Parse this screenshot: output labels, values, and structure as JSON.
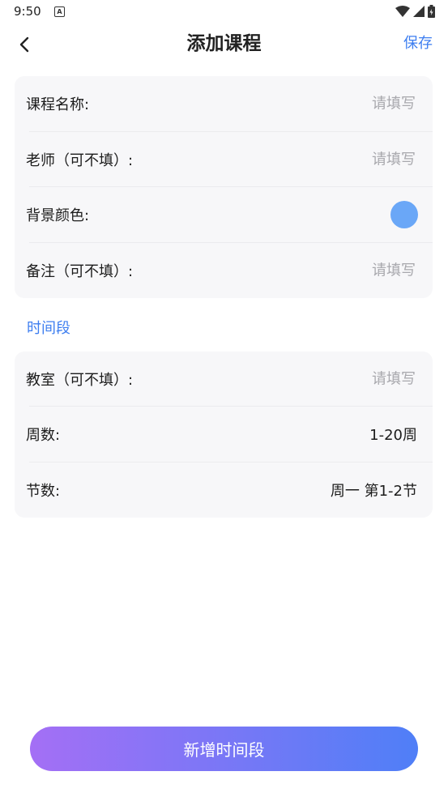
{
  "status_bar": {
    "time": "9:50",
    "a_icon_glyph": "A",
    "icons": [
      "wifi-icon",
      "signal-icon",
      "battery-icon"
    ]
  },
  "header": {
    "title": "添加课程",
    "save_label": "保存",
    "back_icon": "chevron-left-icon"
  },
  "course_info": {
    "rows": [
      {
        "label": "课程名称:",
        "placeholder": "请填写",
        "value": ""
      },
      {
        "label": "老师（可不填）:",
        "placeholder": "请填写",
        "value": ""
      },
      {
        "label": "背景颜色:",
        "color": "#6aa7f7"
      },
      {
        "label": "备注（可不填）:",
        "placeholder": "请填写",
        "value": ""
      }
    ]
  },
  "time_section": {
    "title": "时间段",
    "rows": [
      {
        "label": "教室（可不填）:",
        "placeholder": "请填写",
        "value": ""
      },
      {
        "label": "周数:",
        "value": "1-20周"
      },
      {
        "label": "节数:",
        "value": "周一 第1-2节"
      }
    ]
  },
  "add_button": {
    "label": "新增时间段",
    "gradient_start": "#a46ff5",
    "gradient_end": "#4f7ff7"
  },
  "colors": {
    "accent": "#3d7ef0",
    "card_background": "#f7f7f9"
  }
}
